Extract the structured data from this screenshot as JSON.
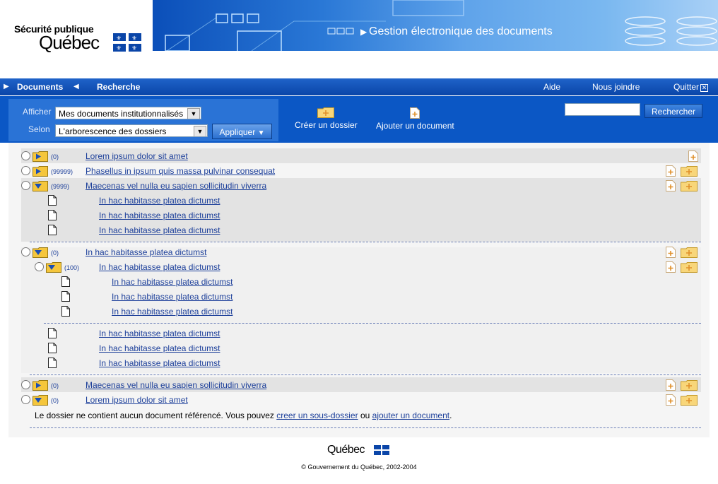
{
  "header": {
    "logo_line1": "Sécurité publique",
    "logo_line2": "Québec",
    "banner_title": "Gestion électronique des documents"
  },
  "nav": {
    "documents": "Documents",
    "recherche": "Recherche",
    "aide": "Aide",
    "nous_joindre": "Nous joindre",
    "quitter": "Quitter"
  },
  "toolbar": {
    "afficher_label": "Afficher",
    "afficher_value": "Mes documents institutionnalisés",
    "selon_label": "Selon",
    "selon_value": "L'arborescence des dossiers",
    "apply_label": "Appliquer",
    "create_folder": "Créer un dossier",
    "add_document": "Ajouter un document",
    "search_value": "",
    "search_button": "Rechercher"
  },
  "tree": {
    "r1": {
      "count": "(0)",
      "label": "Lorem ipsum dolor sit amet"
    },
    "r2": {
      "count": "(99999)",
      "label": "Phasellus in ipsum quis massa pulvinar consequat"
    },
    "r3": {
      "count": "(9999)",
      "label": "Maecenas vel nulla eu sapien sollicitudin viverra"
    },
    "r3_docs": [
      "In hac habitasse platea dictumst",
      "In hac habitasse platea dictumst",
      "In hac habitasse platea dictumst"
    ],
    "r4": {
      "count": "(0)",
      "label": "In hac habitasse platea dictumst"
    },
    "r4a": {
      "count": "(100)",
      "label": "In hac habitasse platea dictumst"
    },
    "r4a_docs": [
      "In hac habitasse platea dictumst",
      "In hac habitasse platea dictumst",
      "In hac habitasse platea dictumst"
    ],
    "r4_docs": [
      "In hac habitasse platea dictumst",
      "In hac habitasse platea dictumst",
      "In hac habitasse platea dictumst"
    ],
    "r5": {
      "count": "(0)",
      "label": "Maecenas vel nulla eu sapien sollicitudin viverra"
    },
    "r6": {
      "count": "(0)",
      "label": "Lorem ipsum dolor sit amet"
    },
    "empty_msg_pre": "Le dossier ne contient aucun document référencé. Vous pouvez",
    "empty_link1": "creer un sous-dossier",
    "empty_mid": "ou",
    "empty_link2": "ajouter un document",
    "empty_post": "."
  },
  "footer": {
    "logo": "Québec",
    "copyright": "© Gouvernement du Québec, 2002-2004"
  },
  "colors": {
    "link": "#1c3f9a",
    "nav_bg": "#0a45a8",
    "toolbar_bg": "#0b57c5",
    "folder": "#f3c23a",
    "folder_arrow": "#1a4fb5"
  }
}
